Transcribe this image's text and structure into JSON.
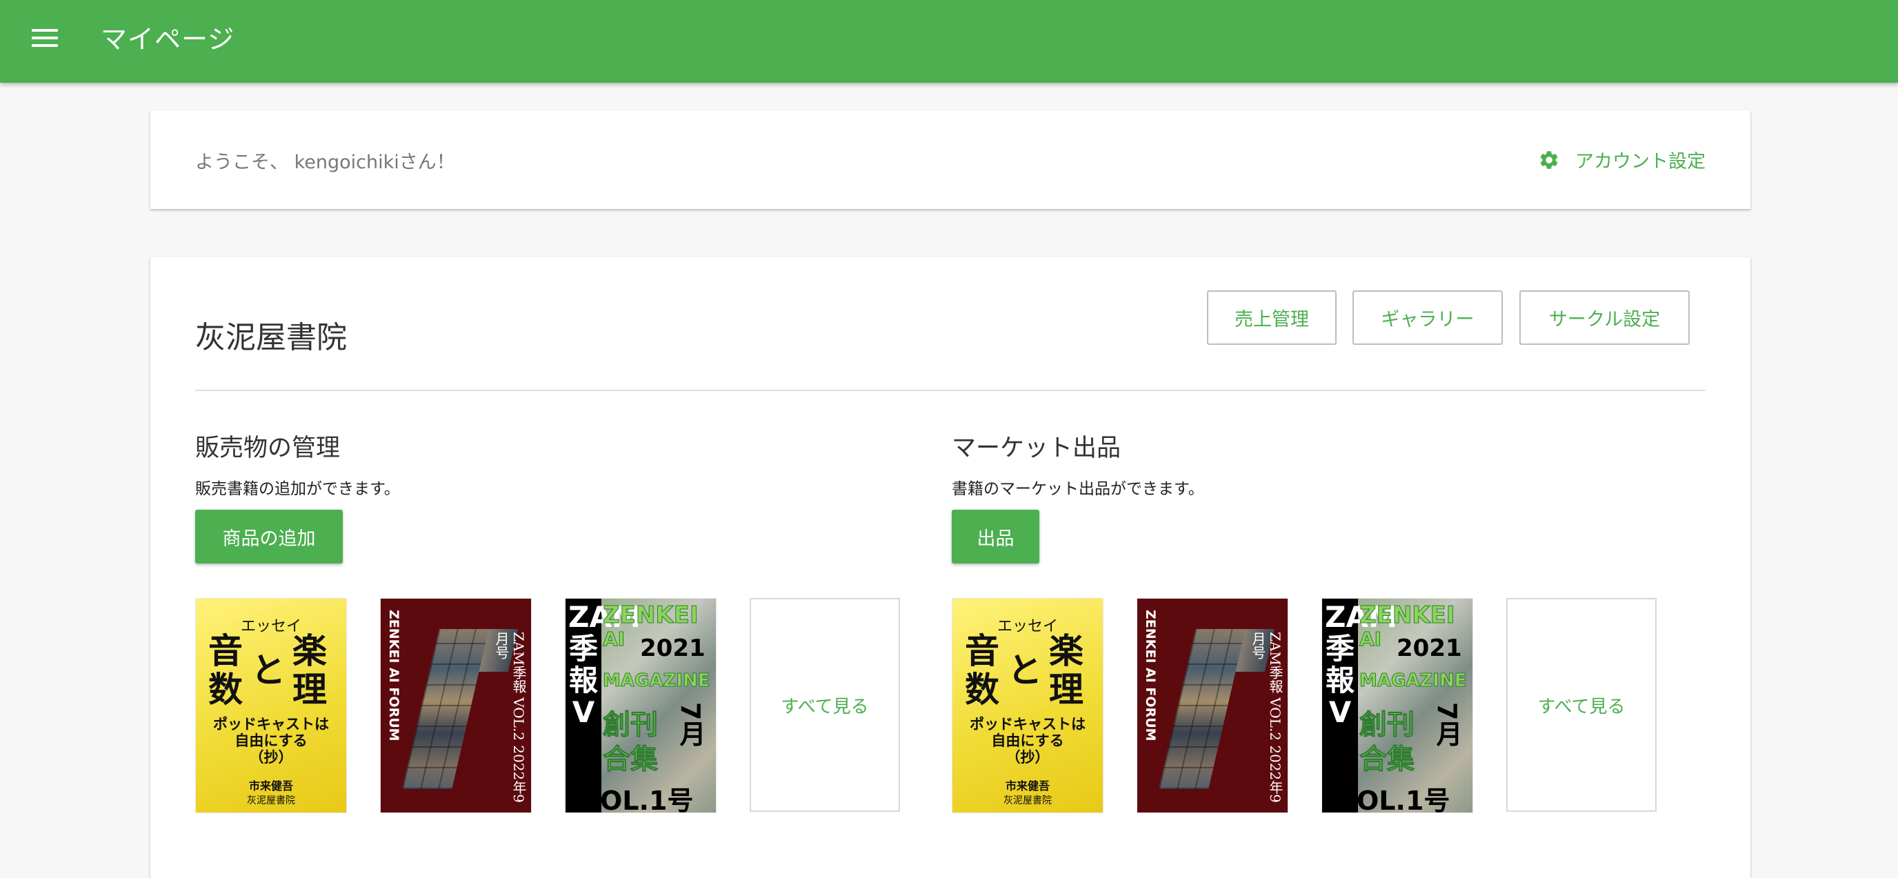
{
  "appbar": {
    "title": "マイページ"
  },
  "welcome": {
    "text": "ようこそ、 kengoichikiさん！",
    "account_link": "アカウント設定"
  },
  "circle": {
    "name": "灰泥屋書院",
    "buttons": {
      "sales": "売上管理",
      "gallery": "ギャラリー",
      "settings": "サークル設定"
    }
  },
  "sections": {
    "products": {
      "title": "販売物の管理",
      "description": "販売書籍の追加ができます。",
      "button": "商品の追加",
      "see_all": "すべて見る"
    },
    "market": {
      "title": "マーケット出品",
      "description": "書籍のマーケット出品ができます。",
      "button": "出品",
      "see_all": "すべて見る"
    }
  },
  "covers": {
    "book1": {
      "essay": "エッセイ",
      "big1": "音",
      "big2": "楽",
      "big3": "と",
      "big4": "数",
      "big5": "理",
      "subtitle1": "ポッドキャストは",
      "subtitle2": "自由にする",
      "subtitle3": "（抄）",
      "author": "市来健吾",
      "publisher": "灰泥屋書院"
    },
    "book2": {
      "left_text": "ZENKEI AI FORUM",
      "right_text": "ZAM季報 VOL.2 2022年9月号"
    },
    "book3": {
      "strip_text": "ZAM季報V",
      "green1": "ZENKEI",
      "green2": "AI",
      "green3": "MAGAZINE",
      "black1": "2021",
      "black2": "7月",
      "green4": "創刊",
      "green5": "合集",
      "black3": "OL.1号"
    }
  },
  "colors": {
    "primary": "#4caf50",
    "cover2_bg": "#5c0a0e",
    "cover1_bg": "#f1dc36"
  }
}
